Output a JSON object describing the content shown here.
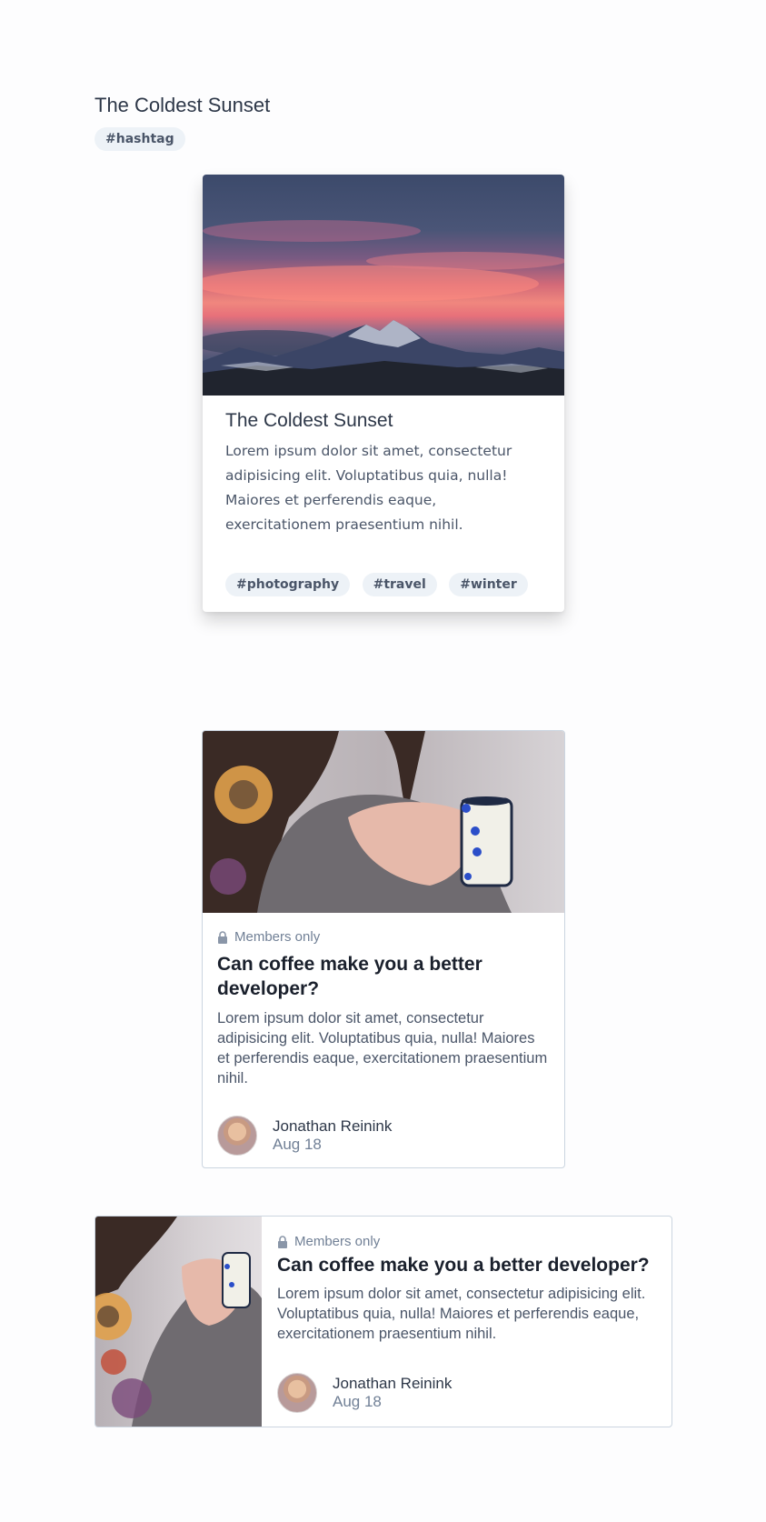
{
  "header": {
    "title": "The Coldest Sunset",
    "tag": "#hashtag"
  },
  "card1": {
    "image_alt": "Sunset in the mountains",
    "title": "The Coldest Sunset",
    "text": "Lorem ipsum dolor sit amet, consectetur adipisicing elit. Voluptatibus quia, nulla! Maiores et perferendis eaque, exercitationem praesentium nihil.",
    "tags": [
      "#photography",
      "#travel",
      "#winter"
    ]
  },
  "card2": {
    "badge": "Members only",
    "title": "Can coffee make you a better developer?",
    "text": "Lorem ipsum dolor sit amet, consectetur adipisicing elit. Voluptatibus quia, nulla! Maiores et perferendis eaque, exercitationem praesentium nihil.",
    "author": {
      "name": "Jonathan Reinink",
      "date": "Aug 18"
    }
  },
  "card3": {
    "badge": "Members only",
    "title": "Can coffee make you a better developer?",
    "text": "Lorem ipsum dolor sit amet, consectetur adipisicing elit. Voluptatibus quia, nulla! Maiores et perferendis eaque, exercitationem praesentium nihil.",
    "author": {
      "name": "Jonathan Reinink",
      "date": "Aug 18"
    }
  },
  "colors": {
    "pill_bg": "#edf2f7",
    "border": "#cbd5e0",
    "muted": "#718096"
  }
}
